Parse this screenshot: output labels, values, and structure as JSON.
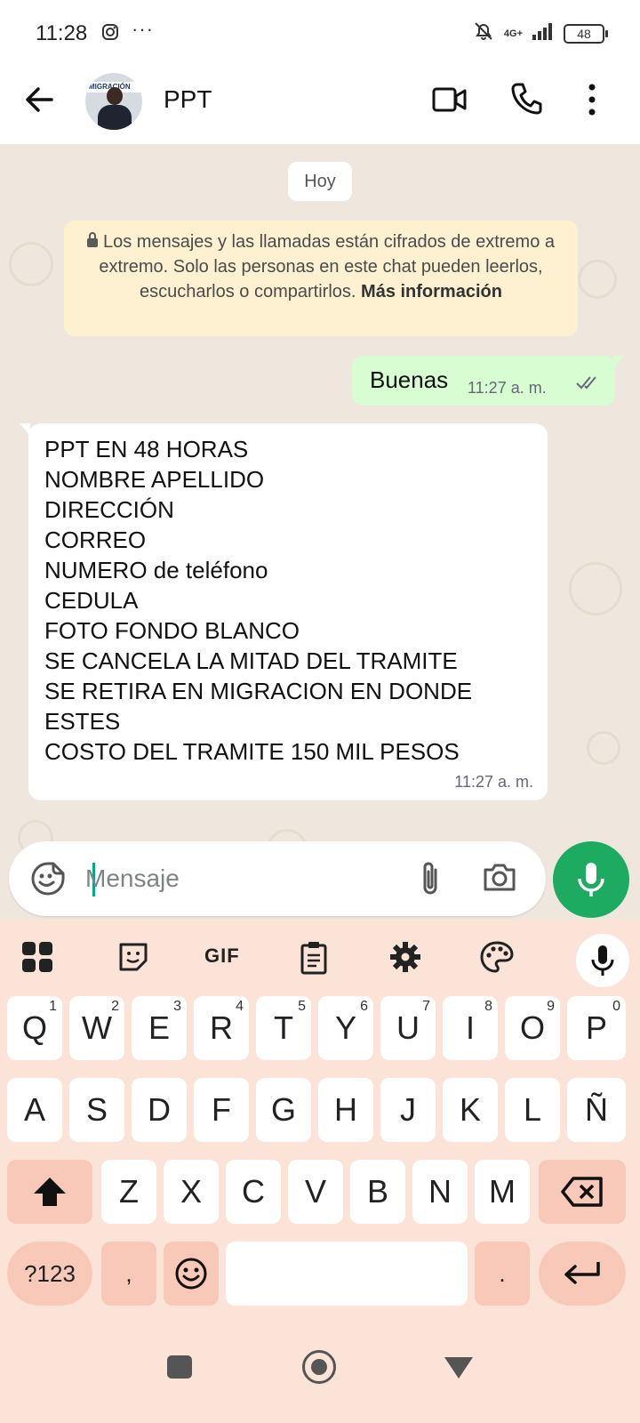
{
  "status_bar": {
    "time": "11:28",
    "overflow": "···",
    "network": "4G+",
    "battery": "48"
  },
  "header": {
    "title": "PPT",
    "avatar_band": "MIGRACIÓN"
  },
  "chat": {
    "date_chip": "Hoy",
    "encryption_notice": "Los mensajes y las llamadas están cifrados de extremo a extremo. Solo las personas en este chat pueden leerlos, escucharlos o compartirlos.",
    "encryption_link": "Más información",
    "outgoing": {
      "text": "Buenas",
      "time": "11:27 a. m."
    },
    "incoming": {
      "lines": [
        "PPT EN 48 HORAS",
        "NOMBRE APELLIDO",
        "DIRECCIÓN",
        "CORREO",
        "NUMERO de teléfono",
        "CEDULA",
        "FOTO FONDO BLANCO",
        "SE CANCELA LA MITAD DEL TRAMITE",
        "SE RETIRA EN MIGRACION EN DONDE",
        "ESTES",
        "COSTO DEL TRAMITE 150 MIL PESOS"
      ],
      "time": "11:27 a. m."
    }
  },
  "composer": {
    "placeholder": "Mensaje",
    "value": ""
  },
  "keyboard": {
    "toolbar": {
      "gif": "GIF"
    },
    "row1": [
      {
        "k": "Q",
        "h": "1"
      },
      {
        "k": "W",
        "h": "2"
      },
      {
        "k": "E",
        "h": "3"
      },
      {
        "k": "R",
        "h": "4"
      },
      {
        "k": "T",
        "h": "5"
      },
      {
        "k": "Y",
        "h": "6"
      },
      {
        "k": "U",
        "h": "7"
      },
      {
        "k": "I",
        "h": "8"
      },
      {
        "k": "O",
        "h": "9"
      },
      {
        "k": "P",
        "h": "0"
      }
    ],
    "row2": [
      "A",
      "S",
      "D",
      "F",
      "G",
      "H",
      "J",
      "K",
      "L",
      "Ñ"
    ],
    "row3": [
      "Z",
      "X",
      "C",
      "V",
      "B",
      "N",
      "M"
    ],
    "row4": {
      "symbols": "?123",
      "comma": ",",
      "period": "."
    }
  },
  "colors": {
    "chat_bg": "#efe7de",
    "outgoing_bubble": "#d9fdd3",
    "accent": "#1daa61",
    "keyboard_bg": "#fce3d8",
    "special_key": "#f8c9b8",
    "notice_bg": "#fdf1d2"
  }
}
